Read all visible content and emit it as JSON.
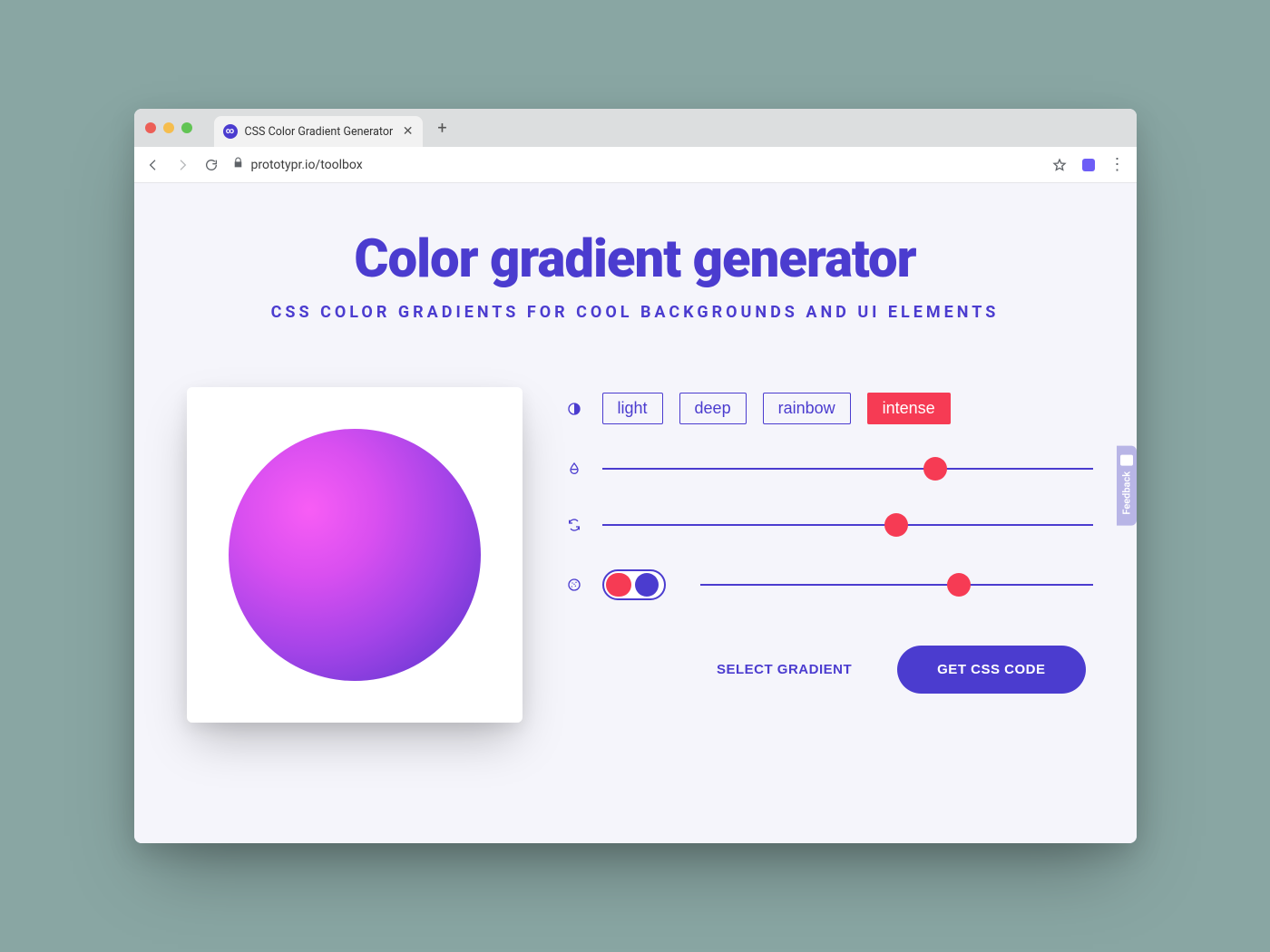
{
  "browser": {
    "tab_title": "CSS Color Gradient Generator",
    "url_display": "prototypr.io/toolbox"
  },
  "header": {
    "title": "Color gradient generator",
    "subtitle": "CSS COLOR GRADIENTS FOR COOL BACKGROUNDS AND UI ELEMENTS"
  },
  "presets": {
    "options": [
      "light",
      "deep",
      "rainbow",
      "intense"
    ],
    "active_index": 3
  },
  "sliders": {
    "hue_pct": 68,
    "rotate_pct": 60,
    "grain_pct": 66
  },
  "toggle": {
    "grain_enabled": true
  },
  "actions": {
    "secondary": "SELECT GRADIENT",
    "primary": "GET CSS CODE"
  },
  "feedback": {
    "label": "Feedback"
  },
  "colors": {
    "accent": "#4b3ccf",
    "danger": "#f63b54"
  }
}
